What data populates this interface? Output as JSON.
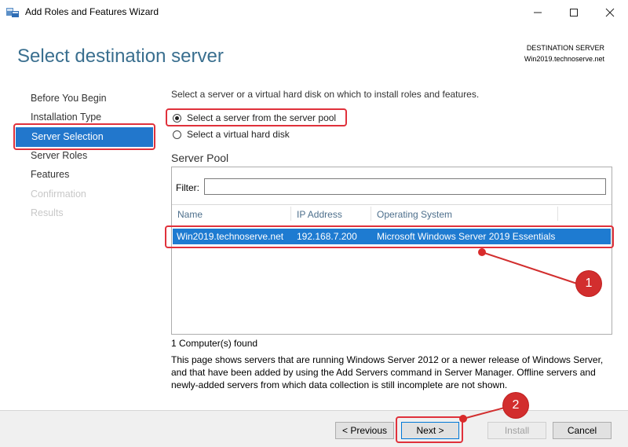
{
  "window": {
    "title": "Add Roles and Features Wizard",
    "minimize": "—",
    "maximize": "☐",
    "close": "✕"
  },
  "header": {
    "page_title": "Select destination server",
    "destination_label": "DESTINATION SERVER",
    "destination_server": "Win2019.technoserve.net"
  },
  "nav": {
    "items": [
      {
        "label": "Before You Begin"
      },
      {
        "label": "Installation Type"
      },
      {
        "label": "Server Selection"
      },
      {
        "label": "Server Roles"
      },
      {
        "label": "Features"
      },
      {
        "label": "Confirmation"
      },
      {
        "label": "Results"
      }
    ]
  },
  "main": {
    "intro": "Select a server or a virtual hard disk on which to install roles and features.",
    "option_pool": "Select a server from the server pool",
    "option_vhd": "Select a virtual hard disk",
    "pool_title": "Server Pool",
    "filter_label": "Filter:",
    "filter_value": "",
    "columns": [
      "Name",
      "IP Address",
      "Operating System"
    ],
    "rows": [
      {
        "name": "Win2019.technoserve.net",
        "ip": "192.168.7.200",
        "os": "Microsoft Windows Server 2019 Essentials"
      }
    ],
    "found": "1 Computer(s) found",
    "description": "This page shows servers that are running Windows Server 2012 or a newer release of Windows Server, and that have been added by using the Add Servers command in Server Manager. Offline servers and newly-added servers from which data collection is still incomplete are not shown."
  },
  "footer": {
    "previous": "< Previous",
    "next": "Next >",
    "install": "Install",
    "cancel": "Cancel"
  },
  "annotations": {
    "badge1": "1",
    "badge2": "2",
    "color": "#d22e2e"
  },
  "colors": {
    "accent": "#2277cc",
    "title": "#3a6f8f",
    "selection": "#1e7bd1"
  }
}
